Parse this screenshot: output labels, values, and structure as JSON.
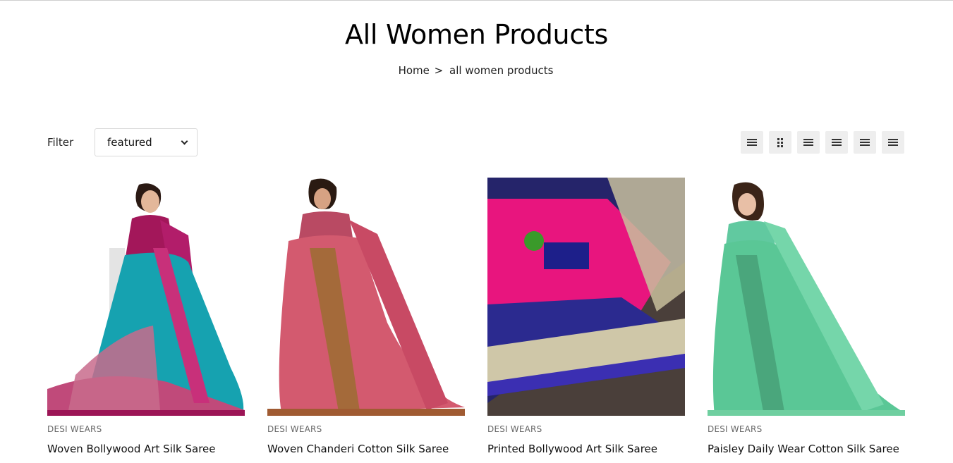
{
  "header": {
    "title": "All Women Products",
    "breadcrumb": {
      "home": "Home",
      "separator": ">",
      "current": "all women products"
    }
  },
  "toolbar": {
    "filter_label": "Filter",
    "sort_selected": "featured",
    "view_buttons": [
      "list-icon",
      "grid-2-icon",
      "grid-3-icon",
      "grid-4-icon",
      "grid-5-icon",
      "grid-6-icon"
    ]
  },
  "products": [
    {
      "brand": "DESI WEARS",
      "name": "Woven Bollywood Art Silk Saree"
    },
    {
      "brand": "DESI WEARS",
      "name": "Woven Chanderi Cotton Silk Saree"
    },
    {
      "brand": "DESI WEARS",
      "name": "Printed Bollywood Art Silk Saree"
    },
    {
      "brand": "DESI WEARS",
      "name": "Paisley Daily Wear Cotton Silk Saree"
    }
  ]
}
